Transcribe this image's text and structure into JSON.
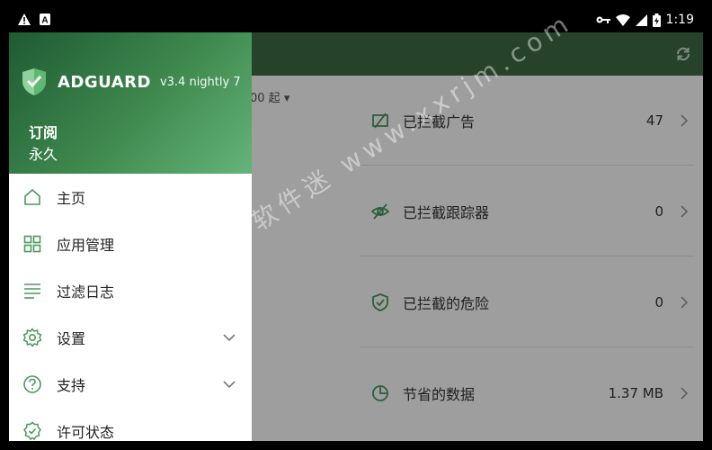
{
  "status_bar": {
    "time": "1:19",
    "left_icons": [
      "warning-icon",
      "a-notification-icon"
    ],
    "right_icons": [
      "vpn-key-icon",
      "wifi-icon",
      "signal-icon",
      "battery-charging-icon"
    ]
  },
  "toolbar": {
    "refresh_icon": "refresh-icon"
  },
  "main": {
    "period_partial": "00 起",
    "stats": [
      {
        "icon": "ad-blocked-icon",
        "label": "已拦截广告",
        "value": "47"
      },
      {
        "icon": "tracker-blocked-icon",
        "label": "已拦截跟踪器",
        "value": "0"
      },
      {
        "icon": "threat-shield-icon",
        "label": "已拦截的危险",
        "value": "0"
      },
      {
        "icon": "data-saved-icon",
        "label": "节省的数据",
        "value": "1.37 MB"
      }
    ]
  },
  "drawer": {
    "brand": "ADGUARD",
    "version": "v3.4 nightly 7",
    "subscription_title": "订阅",
    "subscription_value": "永久",
    "menu": [
      {
        "icon": "home-icon",
        "label": "主页",
        "expandable": false
      },
      {
        "icon": "apps-icon",
        "label": "应用管理",
        "expandable": false
      },
      {
        "icon": "filter-log-icon",
        "label": "过滤日志",
        "expandable": false
      },
      {
        "icon": "settings-icon",
        "label": "设置",
        "expandable": true
      },
      {
        "icon": "help-icon",
        "label": "支持",
        "expandable": true
      },
      {
        "icon": "license-icon",
        "label": "许可状态",
        "expandable": false
      }
    ]
  },
  "watermark": "小小软件迷 www.xxrjm.com",
  "colors": {
    "accent_green": "#3f8a4f",
    "toolbar_green": "#3e6b45",
    "icon_green": "#4a9a5c"
  }
}
